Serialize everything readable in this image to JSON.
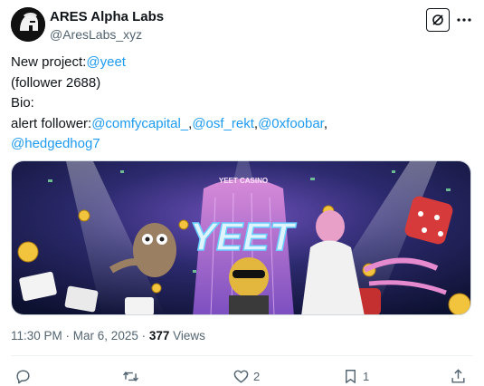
{
  "author": {
    "display_name": "ARES Alpha Labs",
    "handle": "@AresLabs_xyz"
  },
  "tweet": {
    "line1_prefix": "New project:",
    "line1_mention": "@yeet",
    "line2": "(follower 2688)",
    "line3": "Bio:",
    "line4_prefix": "alert follower:",
    "mentions": [
      "@comfycapital_",
      "@osf_rekt",
      "@0xfoobar",
      "@hedgedhog7"
    ],
    "separators": [
      ",",
      ",",
      ","
    ]
  },
  "media": {
    "banner_text": "YEET",
    "building_sign": "YEET CASINO"
  },
  "meta": {
    "time": "11:30 PM",
    "sep1": " · ",
    "date": "Mar 6, 2025",
    "sep2": " · ",
    "views_count": "377",
    "views_label": " Views"
  },
  "actions": {
    "reply_icon": "reply-icon",
    "repost_icon": "repost-icon",
    "like_icon": "heart-icon",
    "like_count": "2",
    "bookmark_icon": "bookmark-icon",
    "bookmark_count": "1",
    "share_icon": "share-icon"
  },
  "colors": {
    "link": "#1d9bf0",
    "text": "#0f1419",
    "secondary": "#536471"
  }
}
